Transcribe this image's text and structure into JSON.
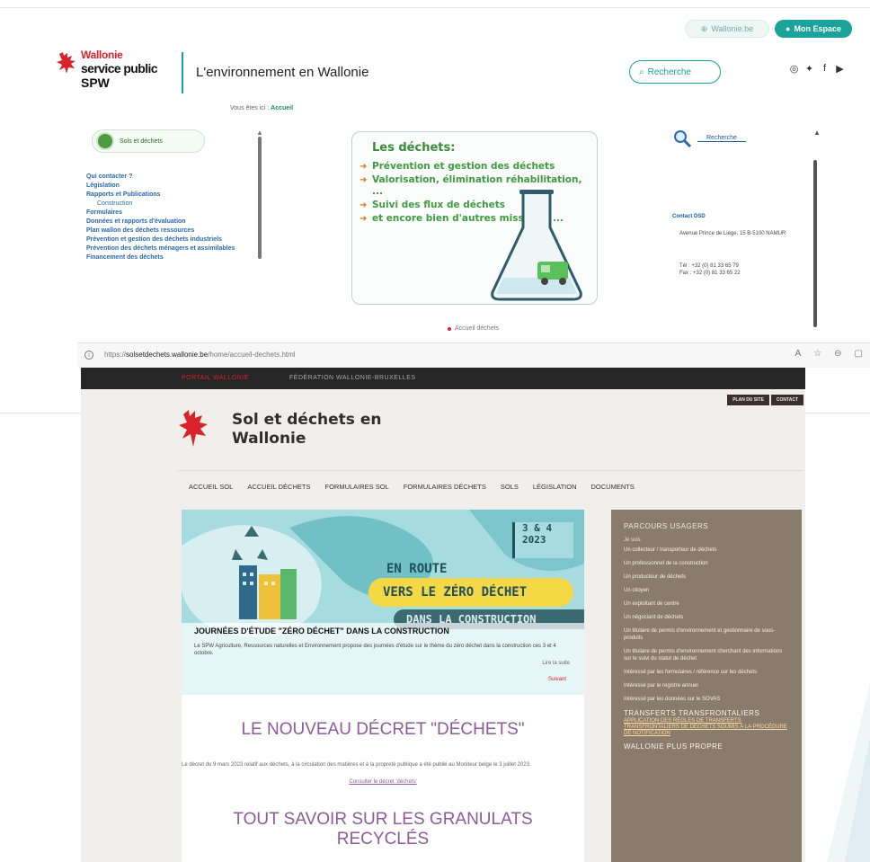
{
  "spw": {
    "pill_light": "Wallonie.be",
    "pill_dark": "Mon Espace",
    "logo_line1": "Wallonie",
    "logo_line2": "service public",
    "logo_line3": "SPW",
    "site_title": "L'environnement en Wallonie",
    "search_label": "Recherche",
    "socials": [
      "instagram-icon",
      "twitter-icon",
      "facebook-icon",
      "youtube-icon"
    ]
  },
  "old_site": {
    "breadcrumb_prefix": "Vous êtes ici :",
    "breadcrumb_current": "Accueil",
    "nav_button": "Sols et déchets",
    "nav_items": [
      {
        "label": "Qui contacter ?",
        "sub": false
      },
      {
        "label": "Législation",
        "sub": false
      },
      {
        "label": "Rapports et Publications",
        "sub": false
      },
      {
        "label": "Construction",
        "sub": true
      },
      {
        "label": "Formulaires",
        "sub": false
      },
      {
        "label": "Données et rapports d'évaluation",
        "sub": false
      },
      {
        "label": "Plan wallon des déchets ressources",
        "sub": false
      },
      {
        "label": "Prévention et gestion des déchets industriels",
        "sub": false
      },
      {
        "label": "Prévention des déchets ménagers et assimilables",
        "sub": false
      },
      {
        "label": "Financement des déchets",
        "sub": false
      }
    ],
    "card_title": "Les déchets:",
    "card_items": [
      "Prévention et gestion des déchets",
      "Valorisation, élimination réhabilitation, ...",
      "Suivi des flux de déchets",
      "et encore bien d'autres missions, ..."
    ],
    "right_search": "Recherche",
    "contact_title": "Contact DSD",
    "address": "Avenue Prince de Liège, 15 B-5100 NAMUR",
    "phone": "Tél : +32 (0) 81 33 65 79",
    "fax": "Fax : +32 (0) 81 33 65 22",
    "bottom_bullet": "Accueil déchets"
  },
  "browser": {
    "url_prefix": "https://",
    "url_domain": "solsetdechets.wallonie.be",
    "url_path": "/home/accueil-dechets.html"
  },
  "new_site": {
    "portail": "PORTAIL WALLONIE",
    "federation": "FÉDÉRATION WALLONIE-BRUXELLES",
    "btn_plan": "PLAN DU SITE",
    "btn_contact": "CONTACT",
    "title_line1": "Sol et déchets en",
    "title_line2": "Wallonie",
    "nav": [
      "ACCUEIL SOL",
      "ACCUEIL DÉCHETS",
      "FORMULAIRES SOL",
      "FORMULAIRES DÉCHETS",
      "SOLS",
      "LÉGISLATION",
      "DOCUMENTS"
    ],
    "banner_date1": "3 & 4",
    "banner_date2": "2023",
    "banner_r1": "EN ROUTE",
    "banner_r2": "VERS LE ZÉRO DÉCHET",
    "banner_r3": "DANS LA CONSTRUCTION",
    "banner_head": "JOURNÉES D'ÉTUDE \"ZÉRO DÉCHET\" DANS LA CONSTRUCTION",
    "banner_text": "Le SPW Agriculture, Ressources naturelles et Environnement propose des journées d'étude sur le thème du zéro déchet dans la construction ces 3 et 4 octobre.",
    "banner_more": "Lire la suite",
    "banner_next": "Suivant",
    "news_title": "LE NOUVEAU DÉCRET \"DÉCHETS\"",
    "news_text": "Le décret du 9 mars 2023 relatif aux déchets, à la circulation des matières et à la propreté publique a été publié au Moniteur belge le 3 juillet 2023.",
    "news_link": "Consulter le décret 'déchets'",
    "news_title2a": "TOUT SAVOIR SUR LES GRANULATS",
    "news_title2b": "RECYCLÉS",
    "side_head": "PARCOURS USAGERS",
    "side_sub": "Je suis",
    "side_items": [
      "Un collecteur / transporteur de déchets",
      "Un professionnel de la construction",
      "Un producteur de déchets",
      "Un citoyen",
      "Un exploitant de centre",
      "Un négociant de déchets",
      "Un titulaire de permis d'environnement et gestionnaire de sous-produits",
      "Un titulaire de permis d'environnement cherchant des informations sur le suivi du statut de déchet",
      "Intéressé par les formulaires / référence sur les déchets",
      "Intéressé par le registre annuel",
      "Intéressé par les données sur le SOVAS"
    ],
    "side_head2": "TRANSFERTS TRANSFRONTALIERS",
    "side_links": "APPLICATION DES RÈGLES DE TRANSFERTS TRANSFRONTALIERS DE DÉCHETS SOUMIS À LA PROCÉDURE DE NOTIFICATION",
    "side_head3": "WALLONIE PLUS PROPRE"
  }
}
